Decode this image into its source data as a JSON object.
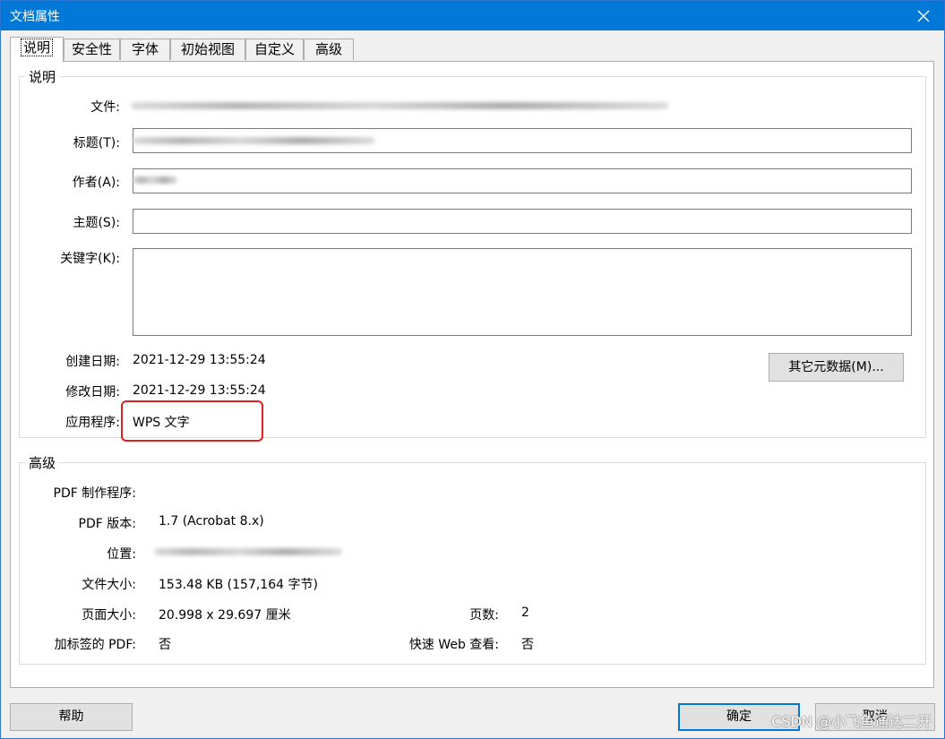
{
  "window": {
    "title": "文档属性"
  },
  "tabs": [
    "说明",
    "安全性",
    "字体",
    "初始视图",
    "自定义",
    "高级"
  ],
  "description": {
    "group_title": "说明",
    "file_label": "文件:",
    "title_label": "标题(T):",
    "author_label": "作者(A):",
    "subject_label": "主题(S):",
    "keywords_label": "关键字(K):",
    "subject_value": "",
    "keywords_value": "",
    "created_label": "创建日期:",
    "created_value": "2021-12-29 13:55:24",
    "modified_label": "修改日期:",
    "modified_value": "2021-12-29 13:55:24",
    "app_label": "应用程序:",
    "app_value": "WPS 文字",
    "more_metadata_button": "其它元数据(M)..."
  },
  "advanced": {
    "group_title": "高级",
    "producer_label": "PDF 制作程序:",
    "version_label": "PDF 版本:",
    "version_value": "1.7 (Acrobat 8.x)",
    "location_label": "位置:",
    "filesize_label": "文件大小:",
    "filesize_value": "153.48 KB (157,164 字节)",
    "pagesize_label": "页面大小:",
    "pagesize_value": "20.998 x 29.697 厘米",
    "pages_label": "页数:",
    "pages_value": "2",
    "tagged_label": "加标签的 PDF:",
    "tagged_value": "否",
    "fastweb_label": "快速 Web 查看:",
    "fastweb_value": "否"
  },
  "footer": {
    "help_button": "帮助",
    "ok_button": "确定",
    "cancel_button": "取消"
  },
  "watermark": "CSDN @小飞鱼通达二开",
  "colors": {
    "titlebar": "#0078d7",
    "highlight": "#e02020"
  }
}
